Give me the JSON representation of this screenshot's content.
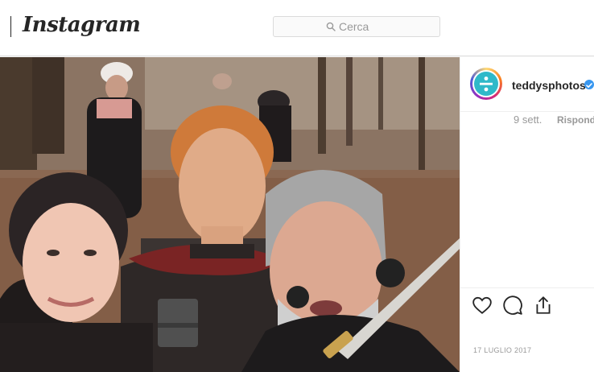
{
  "header": {
    "brand": "Instagram",
    "search": {
      "placeholder": "Cerca"
    }
  },
  "post": {
    "username": "teddysphotos",
    "verified": true,
    "comment_time": "9 sett.",
    "reply_label": "Rispondi",
    "date": "17 LUGLIO 2017"
  },
  "icons": {
    "search": "search-icon",
    "like": "heart-icon",
    "comment": "comment-icon",
    "share": "share-icon",
    "verified": "verified-badge-icon"
  },
  "colors": {
    "verified": "#3897f0",
    "avatar": "#2fb9c9",
    "text": "#262626",
    "muted": "#999999"
  }
}
